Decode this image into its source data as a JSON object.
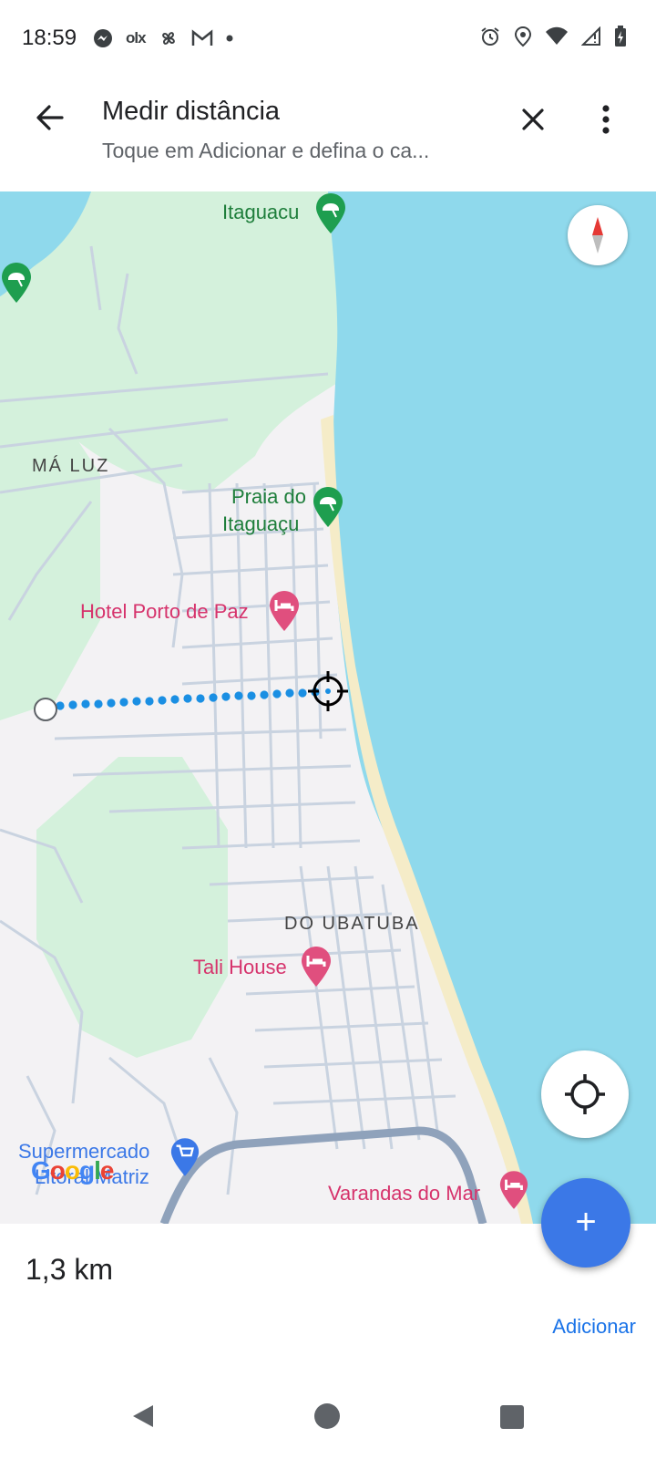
{
  "status_bar": {
    "time": "18:59",
    "left_icons": [
      "messenger-icon",
      "olx-icon",
      "fan-icon",
      "gmail-icon",
      "dot-icon"
    ],
    "olx_text": "olx",
    "right_icons": [
      "alarm-icon",
      "location-icon",
      "wifi-icon",
      "signal-icon",
      "battery-icon"
    ]
  },
  "header": {
    "title": "Medir distância",
    "subtitle": "Toque em Adicionar e defina o ca..."
  },
  "map": {
    "labels": {
      "itaguacu": "Itaguacu",
      "ma_luz": "MÁ LUZ",
      "praia_line1": "Praia do",
      "praia_line2": "Itaguaçu",
      "hotel": "Hotel Porto de Paz",
      "do_ubatuba": "DO UBATUBA",
      "tali_house": "Tali House",
      "supermercado": "Supermercado",
      "litoral_matriz": "Litoral Matriz",
      "varandas": "Varandas do Mar"
    },
    "google_logo": "Google",
    "colors": {
      "water": "#8fd9ec",
      "land": "#f3f2f4",
      "park": "#d4f1dc",
      "beach": "#f5ecc8",
      "road": "#c9d3e0",
      "highway": "#8fa2bb",
      "measure_line": "#1a8fe3",
      "poi_green": "#1e7e3b",
      "poi_pink": "#d6336c"
    }
  },
  "bottom_sheet": {
    "distance": "1,3 km",
    "add_label": "Adicionar"
  },
  "fab": {
    "icon": "plus-icon",
    "symbol": "+"
  },
  "nav": {
    "icons": [
      "back-triangle-icon",
      "home-circle-icon",
      "recents-square-icon"
    ]
  }
}
